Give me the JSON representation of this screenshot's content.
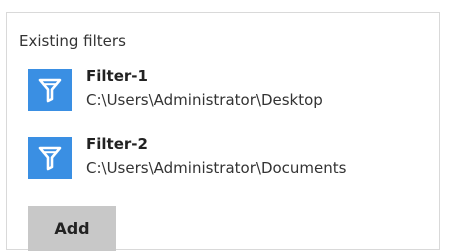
{
  "section": {
    "title": "Existing filters"
  },
  "filters": [
    {
      "name": "Filter-1",
      "path": "C:\\Users\\Administrator\\Desktop",
      "icon": "filter-funnel-icon"
    },
    {
      "name": "Filter-2",
      "path": "C:\\Users\\Administrator\\Documents",
      "icon": "filter-funnel-icon"
    }
  ],
  "actions": {
    "add_label": "Add"
  },
  "colors": {
    "icon_bg": "#3a8fe3",
    "button_bg": "#c8c8c8"
  }
}
